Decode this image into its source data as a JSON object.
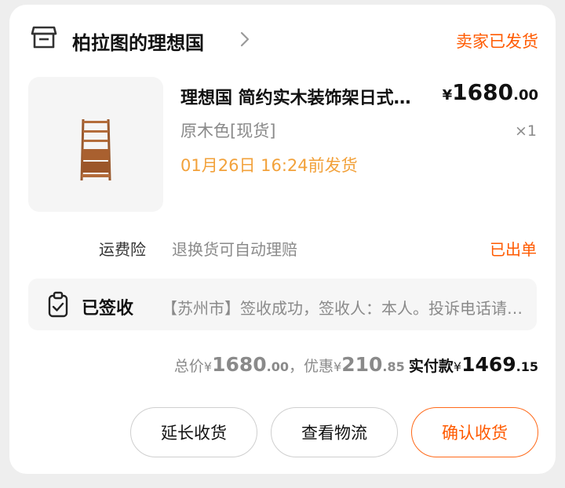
{
  "shop": {
    "name": "柏拉图的理想国",
    "icon": "store-icon"
  },
  "order_status": "卖家已发货",
  "colors": {
    "accent": "#ff5a00",
    "ship_time": "#f2a13a",
    "muted": "#8a8a8a"
  },
  "product": {
    "title": "理想国 简约实木装饰架日式落地书架",
    "price_currency": "¥",
    "price_int": "1680",
    "price_dec": ".00",
    "sku": "原木色[现货]",
    "quantity": "×1",
    "ship_by": "01月26日 16:24前发货",
    "image": "wooden-shelf-icon"
  },
  "insurance": {
    "label": "运费险",
    "description": "退换货可自动理赔",
    "status": "已出单"
  },
  "logistics": {
    "icon": "clipboard-check-icon",
    "status": "已签收",
    "detail": "【苏州市】签收成功，签收人：本人。投诉电话请联系快递员"
  },
  "totals": {
    "total_label": "总价",
    "total_currency": "¥",
    "total_int": "1680",
    "total_dec": ".00",
    "separator": "，",
    "discount_label": "优惠",
    "discount_currency": "¥",
    "discount_int": "210",
    "discount_dec": ".85",
    "paid_label": "实付款",
    "paid_currency": "¥",
    "paid_int": "1469",
    "paid_dec": ".15"
  },
  "buttons": {
    "extend": "延长收货",
    "logistics": "查看物流",
    "confirm": "确认收货"
  }
}
